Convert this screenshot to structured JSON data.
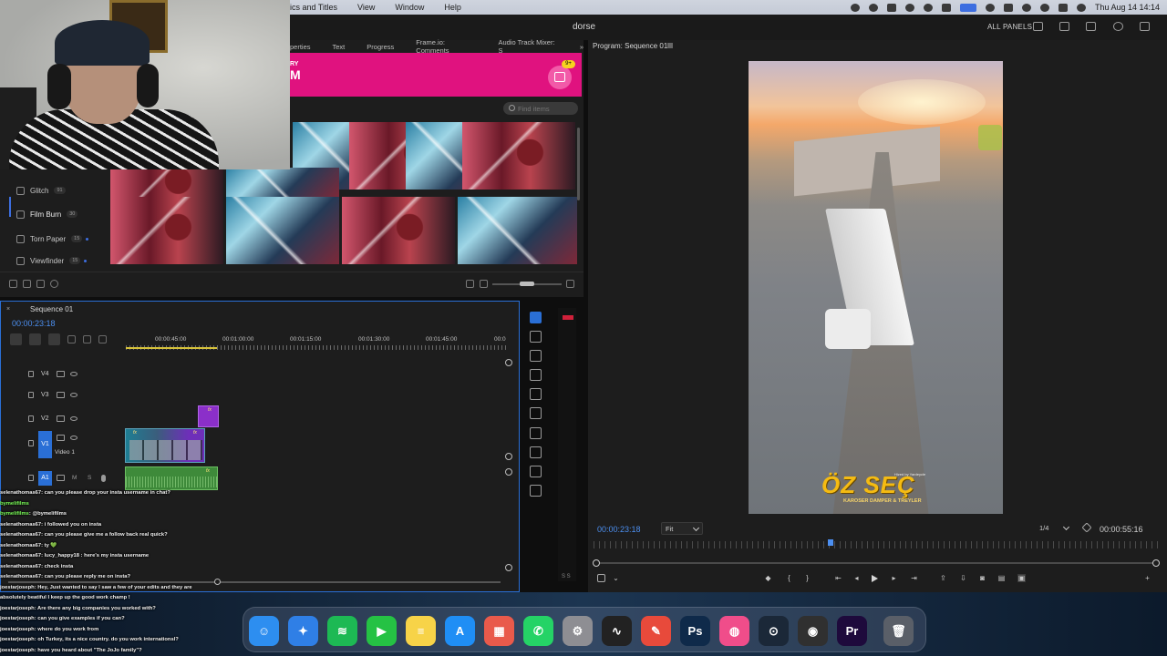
{
  "menubar": {
    "menus": [
      "ics and Titles",
      "View",
      "Window",
      "Help"
    ],
    "clock": "Thu Aug 14  14:14"
  },
  "titlebar": {
    "document": "dorse",
    "panels": "ALL PANELS"
  },
  "effects_panel": {
    "tabs": [
      "perties",
      "Text",
      "Progress",
      "Frame.io: Comments",
      "Audio Track Mixer: S"
    ],
    "banner_small": "RY",
    "banner_big": "M",
    "cart_badge": "9+",
    "search_placeholder": "Find items",
    "categories": [
      {
        "label": "Glitch",
        "count": "91"
      },
      {
        "label": "Film Burn",
        "count": "30"
      },
      {
        "label": "Torn Paper",
        "count": "15"
      },
      {
        "label": "Viewfinder",
        "count": "15"
      }
    ]
  },
  "program": {
    "title": "Program: Sequence 01",
    "timecode_left": "00:00:23:18",
    "fit": "Fit",
    "resolution": "1/4",
    "timecode_right": "00:00:55:16",
    "video_logo": "ÖZ SEÇ",
    "video_sub": "KAROSER DAMPER & TREYLER",
    "video_tiny": "Hized by Yardeycle"
  },
  "timeline": {
    "tab": "Sequence 01",
    "timecode": "00:00:23:18",
    "ruler": [
      "00:00:45:00",
      "00:01:00:00",
      "00:01:15:00",
      "00:01:30:00",
      "00:01:45:00",
      "00:0"
    ],
    "tracks": {
      "v4": "V4",
      "v3": "V3",
      "v2": "V2",
      "v1_src": "V1",
      "v1_name": "Video 1",
      "a1_src": "A1",
      "a1_m": "M",
      "a1_s": "S"
    },
    "fx": "fx"
  },
  "meter": {
    "label": "S S"
  },
  "chat": [
    {
      "user": "selenathomas67",
      "msg": ": can you please drop your insta username in chat?"
    },
    {
      "user": "bymelifilms",
      "msg": "",
      "green": true
    },
    {
      "user": "bymelifilms",
      "msg": ": @bymelifilms",
      "green": true
    },
    {
      "user": "selenathomas67",
      "msg": ": i followed you on insta"
    },
    {
      "user": "selenathomas67",
      "msg": ": can you please give me a follow back real quick?"
    },
    {
      "user": "selenathomas67",
      "msg": ": ty 💚"
    },
    {
      "user": "selenathomas67",
      "msg": ": lucy_happy18 : here's my insta username"
    },
    {
      "user": "selenathomas67",
      "msg": ": check insta"
    },
    {
      "user": "selenathomas67",
      "msg": ": can you please reply me on insta?"
    },
    {
      "user": "joestarjoseph",
      "msg": ": Hey, Just wanted to say I saw a few of your edits and they are"
    },
    {
      "user": "",
      "msg": "absolutely beatiful I keep up the good work champ !"
    },
    {
      "user": "joestarjoseph",
      "msg": ": Are there any big companies you worked with?"
    },
    {
      "user": "joestarjoseph",
      "msg": ": can you give examples if you can?"
    },
    {
      "user": "joestarjoseph",
      "msg": ": where do you work from"
    },
    {
      "user": "joestarjoseph",
      "msg": ": oh Turkey, its a nice country. do you work internationsl?"
    },
    {
      "user": "joestarjoseph",
      "msg": ": have you heard about \"The JoJo family\"?"
    }
  ],
  "dock": [
    {
      "name": "finder",
      "glyph": "☺",
      "color": "#2d8ef0"
    },
    {
      "name": "safari",
      "glyph": "✦",
      "color": "#2f7fe6"
    },
    {
      "name": "spotify",
      "glyph": "≋",
      "color": "#1db954"
    },
    {
      "name": "facetime",
      "glyph": "▶",
      "color": "#25c244"
    },
    {
      "name": "notes",
      "glyph": "≡",
      "color": "#f7d348"
    },
    {
      "name": "app-store",
      "glyph": "A",
      "color": "#1f8ef5"
    },
    {
      "name": "launchpad",
      "glyph": "▦",
      "color": "#e95a4b"
    },
    {
      "name": "whatsapp",
      "glyph": "✆",
      "color": "#25d366"
    },
    {
      "name": "system-settings",
      "glyph": "⚙",
      "color": "#8e8e93"
    },
    {
      "name": "activity-monitor",
      "glyph": "∿",
      "color": "#222222"
    },
    {
      "name": "pencil-app",
      "glyph": "✎",
      "color": "#e84a3b"
    },
    {
      "name": "photoshop",
      "glyph": "Ps",
      "color": "#0f2a4a"
    },
    {
      "name": "browser",
      "glyph": "◍",
      "color": "#f04d8a"
    },
    {
      "name": "steam",
      "glyph": "⊙",
      "color": "#1b2838"
    },
    {
      "name": "obs",
      "glyph": "◉",
      "color": "#303030"
    },
    {
      "name": "premiere-pro",
      "glyph": "Pr",
      "color": "#1e0a3c"
    },
    {
      "name": "trash",
      "glyph": "🗑",
      "color": "#5a5f68"
    }
  ]
}
